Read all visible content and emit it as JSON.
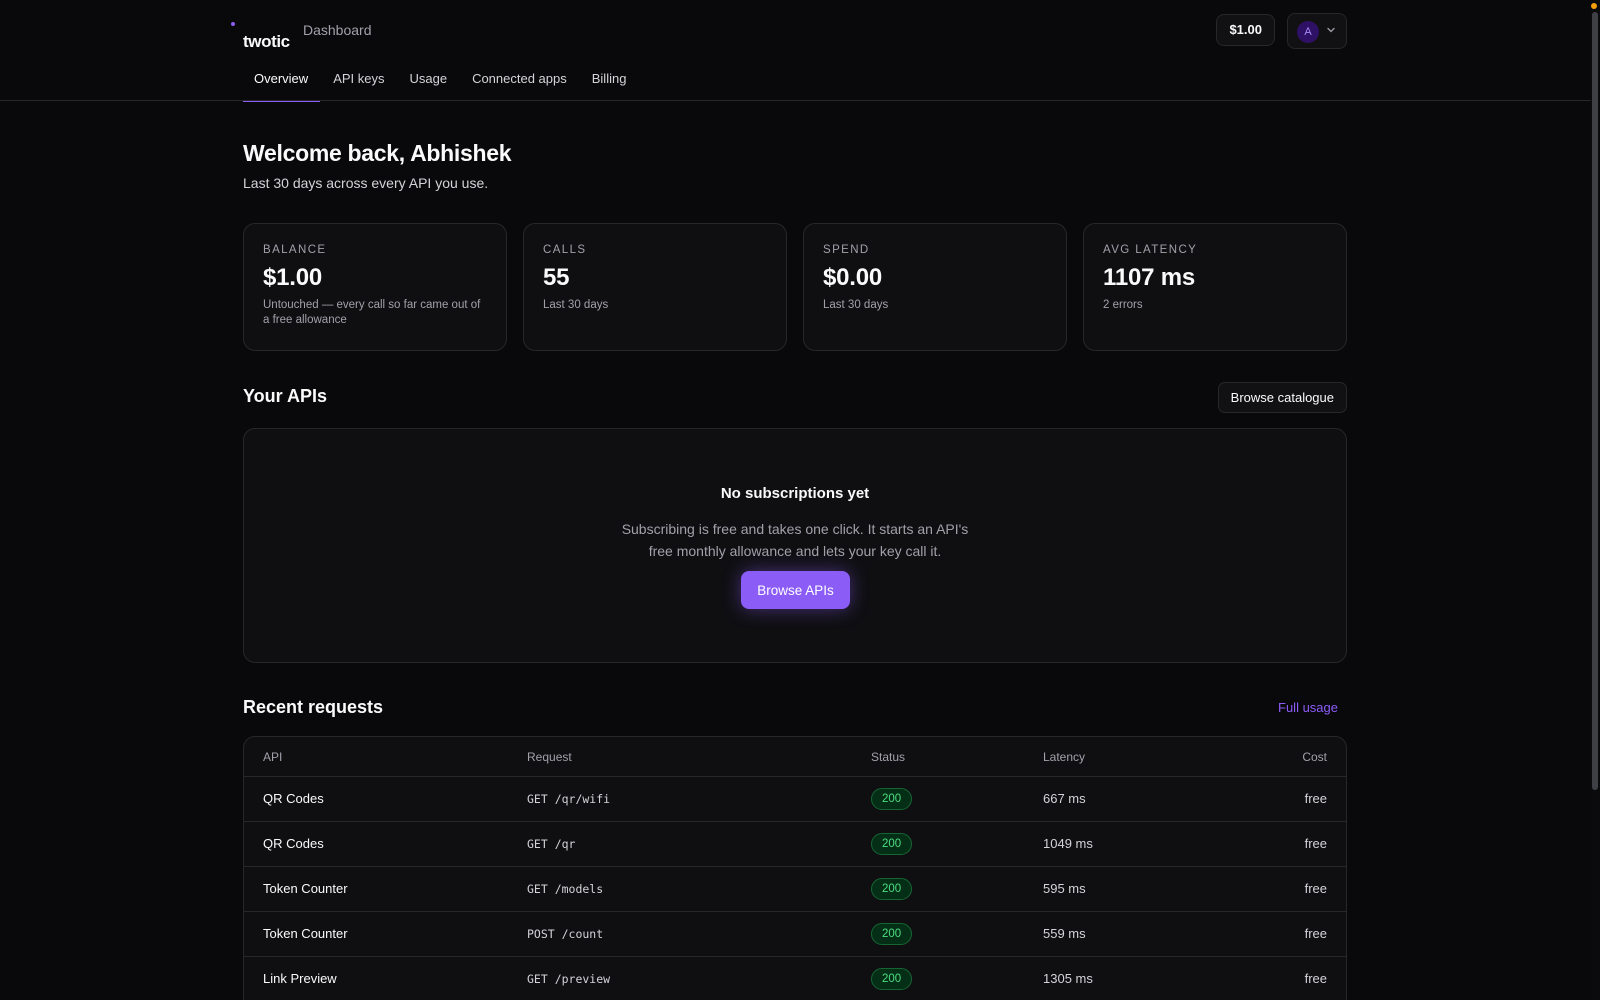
{
  "header": {
    "brand": "twotic",
    "breadcrumb": "Dashboard",
    "balance": "$1.00",
    "avatar_initial": "A"
  },
  "tabs": [
    {
      "label": "Overview",
      "active": true
    },
    {
      "label": "API keys",
      "active": false
    },
    {
      "label": "Usage",
      "active": false
    },
    {
      "label": "Connected apps",
      "active": false
    },
    {
      "label": "Billing",
      "active": false
    }
  ],
  "welcome": {
    "title": "Welcome back, Abhishek",
    "subtitle": "Last 30 days across every API you use."
  },
  "stats": [
    {
      "label": "BALANCE",
      "value": "$1.00",
      "note": "Untouched — every call so far came out of a free allowance"
    },
    {
      "label": "CALLS",
      "value": "55",
      "note": "Last 30 days"
    },
    {
      "label": "SPEND",
      "value": "$0.00",
      "note": "Last 30 days"
    },
    {
      "label": "AVG LATENCY",
      "value": "1107 ms",
      "note": "2 errors"
    }
  ],
  "apis": {
    "title": "Your APIs",
    "browse_catalogue_label": "Browse catalogue",
    "empty_title": "No subscriptions yet",
    "empty_line1": "Subscribing is free and takes one click. It starts an API's",
    "empty_line2": "free monthly allowance and lets your key call it.",
    "browse_apis_label": "Browse APIs"
  },
  "requests": {
    "title": "Recent requests",
    "full_usage_label": "Full usage",
    "columns": {
      "api": "API",
      "request": "Request",
      "status": "Status",
      "latency": "Latency",
      "cost": "Cost"
    },
    "rows": [
      {
        "api": "QR Codes",
        "request": "GET /qr/wifi",
        "status": "200",
        "latency": "667 ms",
        "cost": "free"
      },
      {
        "api": "QR Codes",
        "request": "GET /qr",
        "status": "200",
        "latency": "1049 ms",
        "cost": "free"
      },
      {
        "api": "Token Counter",
        "request": "GET /models",
        "status": "200",
        "latency": "595 ms",
        "cost": "free"
      },
      {
        "api": "Token Counter",
        "request": "POST /count",
        "status": "200",
        "latency": "559 ms",
        "cost": "free"
      },
      {
        "api": "Link Preview",
        "request": "GET /preview",
        "status": "200",
        "latency": "1305 ms",
        "cost": "free"
      }
    ]
  },
  "colors": {
    "accent": "#8b5cf6",
    "background": "#09090b",
    "success": "#4ade80"
  }
}
